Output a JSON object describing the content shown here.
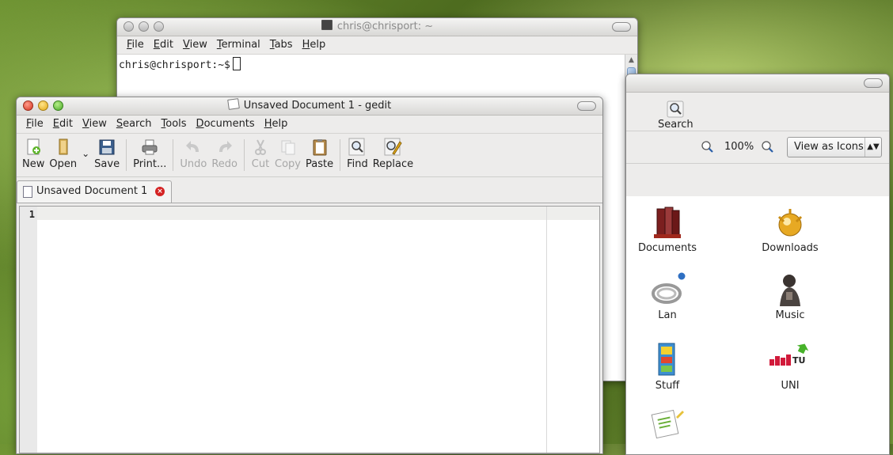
{
  "terminal": {
    "title": "chris@chrisport: ~",
    "menu": [
      "File",
      "Edit",
      "View",
      "Terminal",
      "Tabs",
      "Help"
    ],
    "prompt": "chris@chrisport:~$"
  },
  "filemanager": {
    "search_label": "Search",
    "zoom_level": "100%",
    "view_mode": "View as Icons",
    "items": [
      {
        "label": "Documents"
      },
      {
        "label": "Downloads"
      },
      {
        "label": "Lan"
      },
      {
        "label": "Music"
      },
      {
        "label": "Stuff"
      },
      {
        "label": "UNI"
      }
    ],
    "uni_logo_text": "TU"
  },
  "gedit": {
    "title": "Unsaved Document 1 - gedit",
    "menu": [
      "File",
      "Edit",
      "View",
      "Search",
      "Tools",
      "Documents",
      "Help"
    ],
    "toolbar": {
      "new": "New",
      "open": "Open",
      "save": "Save",
      "print": "Print...",
      "undo": "Undo",
      "redo": "Redo",
      "cut": "Cut",
      "copy": "Copy",
      "paste": "Paste",
      "find": "Find",
      "replace": "Replace"
    },
    "tab_label": "Unsaved Document 1",
    "line_number": "1"
  }
}
